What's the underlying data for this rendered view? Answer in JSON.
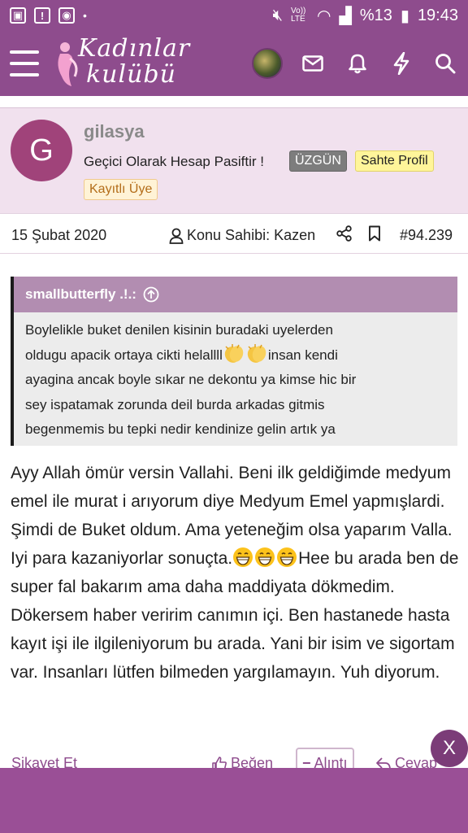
{
  "status_bar": {
    "network": "Vo)) LTE",
    "battery": "%13",
    "time": "19:43"
  },
  "header": {
    "logo_line1": "Kadınlar",
    "logo_line2": "kulübü",
    "icons": [
      "menu-icon",
      "avatar",
      "mail-icon",
      "bell-icon",
      "bolt-icon",
      "search-icon"
    ],
    "brand_color": "#8e4c8d"
  },
  "user": {
    "avatar_letter": "G",
    "name": "gilasya",
    "title": "Geçici Olarak Hesap Pasiftir !",
    "badge_sad": "ÜZGÜN",
    "badge_fake": "Sahte Profil",
    "badge_registered": "Kayıtlı Üye"
  },
  "meta": {
    "date": "15 Şubat 2020",
    "owner": "Konu Sahibi: Kazen",
    "post_number": "#94.239"
  },
  "quote": {
    "author": "smallbutterfly .!.:",
    "line1": "Boylelikle buket denilen kisinin buradaki uyelerden",
    "line2a": "oldugu apacik ortaya cikti helallll",
    "line2b": "insan kendi",
    "line3": "ayagina ancak boyle sıkar ne dekontu ya kimse hic bir",
    "line4": "sey ispatamak zorunda deil burda arkadas gitmis",
    "line5": "begenmemis bu tepki nedir kendinize gelin artık ya"
  },
  "post": {
    "text_a": "Ayy Allah ömür versin Vallahi. Beni ilk geldiğimde medyum emel ile murat i arıyorum diye Medyum Emel yapmışlardi. Şimdi de Buket oldum. Ama yeteneğim olsa yaparım Valla. Iyi para kazaniyorlar sonuçta.",
    "text_b": "Hee bu arada ben de super fal bakarım ama daha maddiyata dökmedim. Dökersem haber veririm canımın içi. Ben hastanede hasta kayıt işi ile ilgileniyorum bu arada. Yani bir isim ve sigortam var. Insanları lütfen bilmeden yargılamayın. Yuh diyorum."
  },
  "actions": {
    "report": "Şikayet Et",
    "like": "Beğen",
    "quote": "Alıntı",
    "reply": "Cevap"
  },
  "ad": {
    "close": "X"
  }
}
